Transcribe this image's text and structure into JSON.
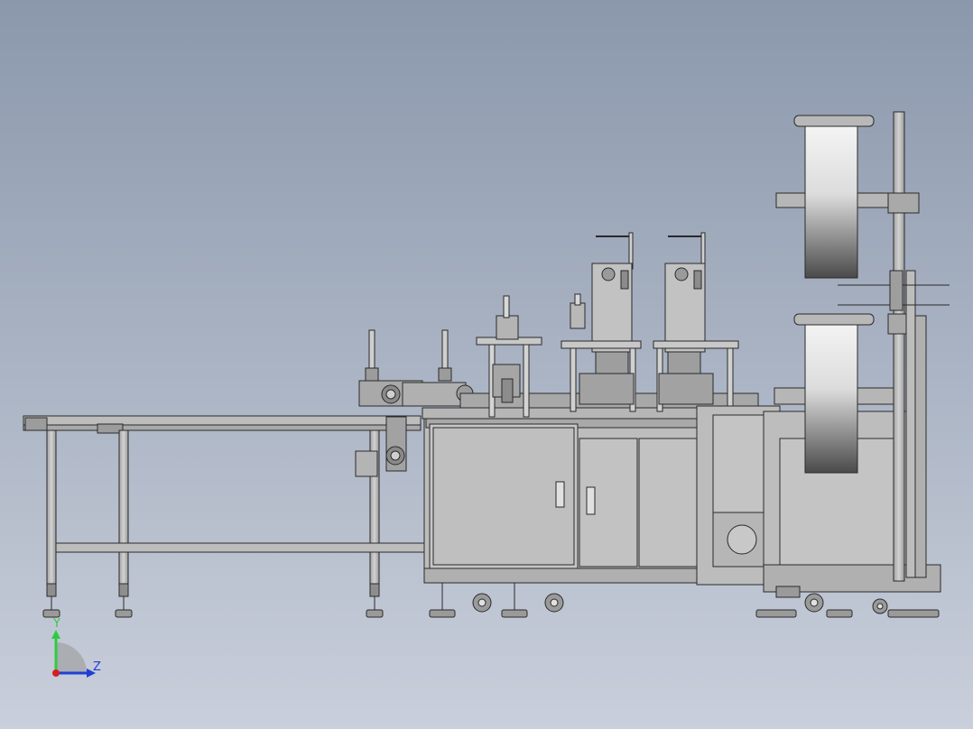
{
  "scene": {
    "background_top": "#8b98ac",
    "background_bottom": "#c9cfdb",
    "line_color": "#2a2a2a",
    "metal_color": "#b9b9b9",
    "metal_dark": "#8e8e8e",
    "panel_color": "#c4c4c4"
  },
  "axis_triad": {
    "y_label": "Y",
    "z_label": "Z",
    "y_color": "#2ecc40",
    "z_color": "#1f3fd6",
    "x_color": "#d42020"
  }
}
